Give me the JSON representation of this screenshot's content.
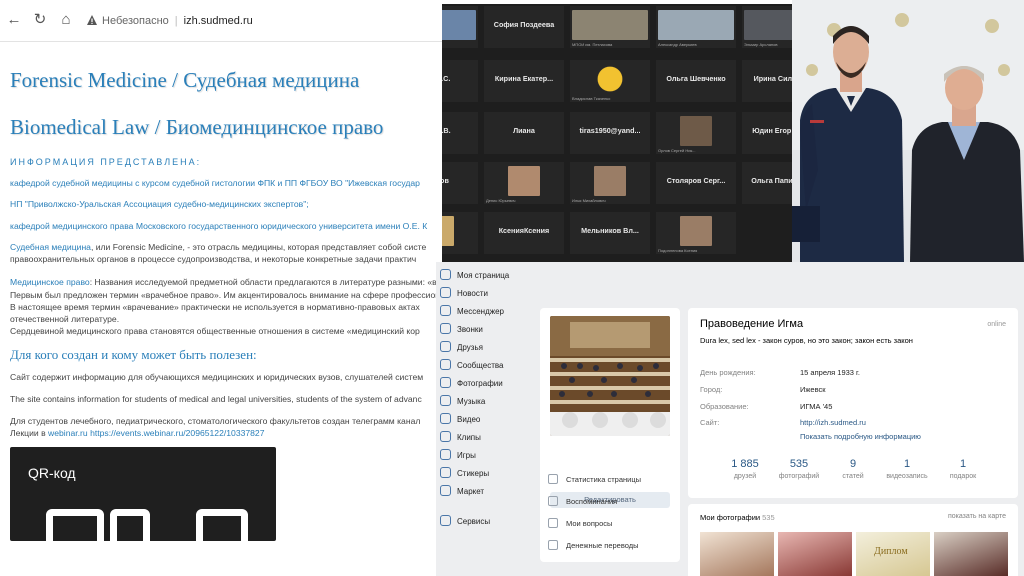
{
  "browser": {
    "security_label": "Небезопасно",
    "host": "izh.sudmed.ru",
    "title_forensic": "Forensic Medicine / Судебная медицина",
    "title_biomedical": "Biomedical Law / Биомединцинское право",
    "info_heading": "ИНФОРМАЦИЯ ПРЕДСТАВЛЕНА:",
    "org1": "кафедрой судебной медицины с курсом судебной гистологии ФПК и ПП ФГБОУ ВО \"Ижевская государ",
    "org2": "НП \"Приволжско-Уральская Ассоциация судебно-медицинских экспертов\";",
    "org3": "кафедрой медицинского права Московского государственного юридического университета имени О.Е. К",
    "para1_link": "Судебная медицина",
    "para1_rest": ", или Forensic Medicine, - это отрасль медицины, которая представляет собой систе",
    "para1_line2": "правоохранительных органов в процессе судопроизводства, и некоторые конкретные задачи практич",
    "para2_link": "Медицинское право",
    "para2_rest": ": Названия исследуемой предметной области предлагаются в литературе разными: «врачебное право», «медицинское право», «биомедицинское право», «здравоохранительное право»,«медицинская юриспруденция».",
    "para2_line2": "Первым был предложен термин «врачебное право». Им акцентировалось внимание на сфере профессиональной деятельности — врачевании, т. е. лечении, исцелении больных лицами, обладающими специальными знаниями и навыками (вр",
    "para2_line3": "В настоящее время термин «врачевание» практически не используется в нормативно-правовых актах",
    "para2_line4": "отечественной литературе.",
    "para2_line5": "Сердцевиной медицинского права становятся общественные отношения в системе «медицинский кор",
    "section_title": "Для кого создан и кому может быть полезен:",
    "who1": "Сайт содержит информацию для обучающихся медицинских и юридических вузов, слушателей систем",
    "who2": "The site contains information for students of medical and legal universities, students of the system of advanc",
    "who3": "Для студентов лечебного, педиатрического, стоматологического факультетов создан телеграмм канал",
    "lectures_prefix": "Лекции в ",
    "lectures_link1": "webinar.ru",
    "lectures_link2": "https://events.webinar.ru/20965122/10337827",
    "qr_title": "QR-код"
  },
  "conference": {
    "tiles": [
      {
        "name": "",
        "sub": ""
      },
      {
        "name": "София Поздеева",
        "sub": ""
      },
      {
        "name": "",
        "sub": "МПОИ им. Петлахова"
      },
      {
        "name": "",
        "sub": "Александр Аверкиев"
      },
      {
        "name": "",
        "sub": "Эльмир Арсланов"
      },
      {
        "name": "на Н.С.",
        "sub": ""
      },
      {
        "name": "Кирина Екатер...",
        "sub": ""
      },
      {
        "name": "",
        "sub": "Владислав Ткаченко"
      },
      {
        "name": "Ольга Шевченко",
        "sub": ""
      },
      {
        "name": "Ирина Силуян...",
        "sub": ""
      },
      {
        "name": "ло Н.В.",
        "sub": ""
      },
      {
        "name": "Лиана",
        "sub": ""
      },
      {
        "name": "tiras1950@yand...",
        "sub": ""
      },
      {
        "name": "",
        "sub": "Орлов Сергей Ник..."
      },
      {
        "name": "Юдин Егор Вит...",
        "sub": ""
      },
      {
        "name": "белов",
        "sub": ""
      },
      {
        "name": "",
        "sub": "Денис Юрьевич"
      },
      {
        "name": "",
        "sub": "Илья Михайлович"
      },
      {
        "name": "Столяров Серг...",
        "sub": ""
      },
      {
        "name": "Ольга Папинигис",
        "sub": ""
      },
      {
        "name": "",
        "sub": ""
      },
      {
        "name": "КсенияКсения",
        "sub": ""
      },
      {
        "name": "Мельников Вл...",
        "sub": ""
      },
      {
        "name": "",
        "sub": "Подоплелова Ксения"
      }
    ]
  },
  "vk": {
    "menu": [
      "Моя страница",
      "Новости",
      "Мессенджер",
      "Звонки",
      "Друзья",
      "Сообщества",
      "Фотографии",
      "Музыка",
      "Видео",
      "Клипы",
      "Игры",
      "Стикеры",
      "Маркет",
      "Сервисы"
    ],
    "edit_button": "Редактировать",
    "actions": [
      "Статистика страницы",
      "Воспоминания",
      "Мои вопросы",
      "Денежные переводы"
    ],
    "profile": {
      "name": "Правоведение Игма",
      "online": "online",
      "status": "Dura lex, sed lex - закон суров, но это закон; закон есть закон",
      "rows": [
        {
          "k": "День рождения:",
          "v": "15 апреля 1933 г."
        },
        {
          "k": "Город:",
          "v": "Ижевск"
        },
        {
          "k": "Образование:",
          "v": "ИГМА '45"
        },
        {
          "k": "Сайт:",
          "v": "http://izh.sudmed.ru"
        }
      ],
      "more": "Показать подробную информацию",
      "counters": [
        {
          "n": "1 885",
          "l": "друзей"
        },
        {
          "n": "535",
          "l": "фотографий"
        },
        {
          "n": "9",
          "l": "статей"
        },
        {
          "n": "1",
          "l": "видеозапись"
        },
        {
          "n": "1",
          "l": "подарок"
        }
      ]
    },
    "photos": {
      "title": "Мои фотографии",
      "count": "535",
      "map_link": "показать на карте",
      "diploma_text": "Диплом"
    }
  },
  "colors": {
    "link": "#2a7fb9",
    "vk_link": "#2a5885",
    "vk_bg": "#edeef0",
    "zoom_bg": "#1e1e1e"
  }
}
